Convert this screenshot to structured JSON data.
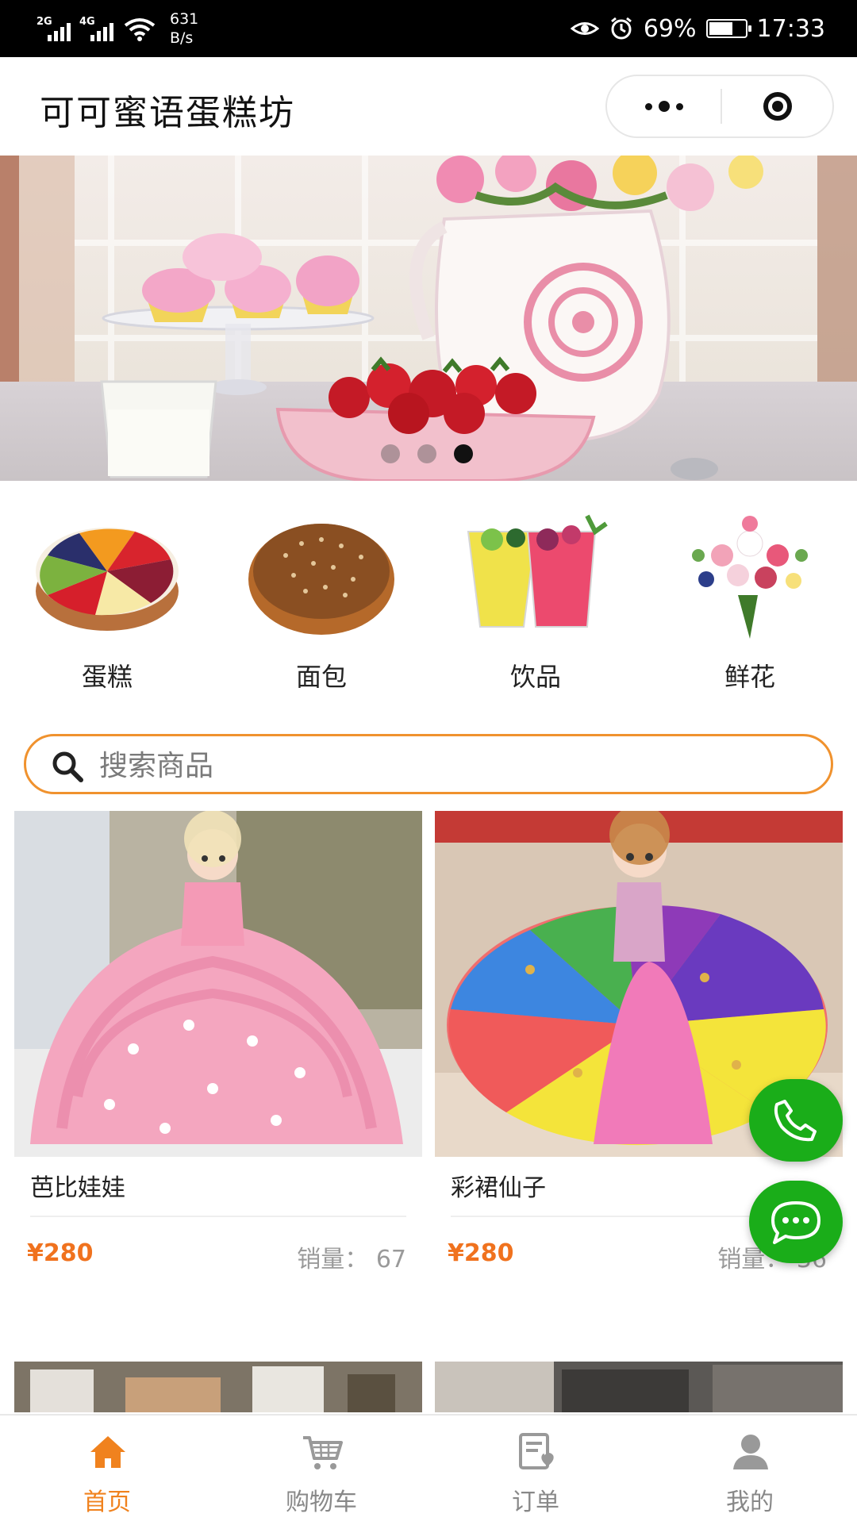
{
  "status_bar": {
    "net1": "2G",
    "net2": "4G",
    "speed_value": "631",
    "speed_unit": "B/s",
    "battery": "69%",
    "battery_level": 0.69,
    "time": "17:33"
  },
  "nav": {
    "title": "可可蜜语蛋糕坊"
  },
  "banner": {
    "slide_count": 3,
    "active_slide": 3
  },
  "categories": [
    {
      "label": "蛋糕",
      "icon": "cake-icon"
    },
    {
      "label": "面包",
      "icon": "bread-icon"
    },
    {
      "label": "饮品",
      "icon": "drinks-icon"
    },
    {
      "label": "鲜花",
      "icon": "flowers-icon"
    }
  ],
  "search": {
    "placeholder": "搜索商品"
  },
  "products": [
    {
      "name": "芭比娃娃",
      "price": "¥280",
      "sales_label": "销量：",
      "sales": "67"
    },
    {
      "name": "彩裙仙子",
      "price": "¥280",
      "sales_label": "销量：",
      "sales": "36"
    }
  ],
  "tabbar": [
    {
      "label": "首页",
      "icon": "home-icon",
      "active": true
    },
    {
      "label": "购物车",
      "icon": "cart-icon",
      "active": false
    },
    {
      "label": "订单",
      "icon": "orders-icon",
      "active": false
    },
    {
      "label": "我的",
      "icon": "profile-icon",
      "active": false
    }
  ],
  "colors": {
    "accent": "#f0821e",
    "price": "#f0721e",
    "fab_green": "#1aad19",
    "search_border": "#f0922e"
  }
}
